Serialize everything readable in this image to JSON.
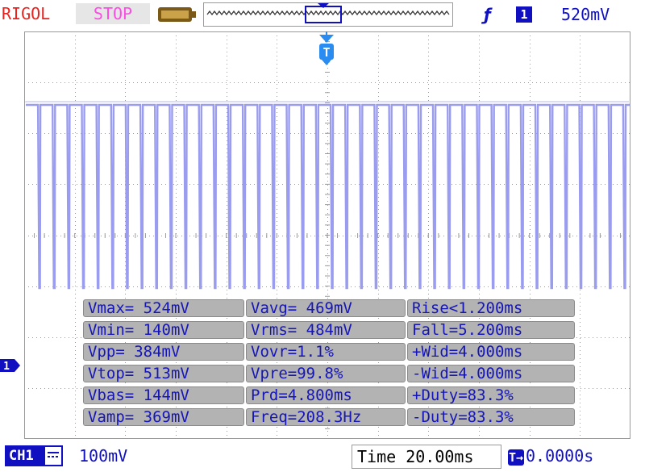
{
  "header": {
    "brand": "RIGOL",
    "run_state": "STOP",
    "trigger": {
      "edge_symbol": "ƒ",
      "source": "1",
      "level": "520mV"
    }
  },
  "trigger_marker_label": "T",
  "channel_marker_label": "1",
  "waveform": {
    "description": "square pulse train, CH1",
    "high_mV": 513,
    "low_mV": 144,
    "pulse_count": 41
  },
  "measurements": {
    "col1": [
      "Vmax= 524mV",
      "Vmin= 140mV",
      "Vpp= 384mV",
      "Vtop= 513mV",
      "Vbas= 144mV",
      "Vamp= 369mV"
    ],
    "col2": [
      "Vavg= 469mV",
      "Vrms= 484mV",
      "Vovr=1.1%",
      "Vpre=99.8%",
      "Prd=4.800ms",
      "Freq=208.3Hz"
    ],
    "col3": [
      "Rise<1.200ms",
      "Fall=5.200ms",
      "+Wid=4.000ms",
      "-Wid=4.000ms",
      "+Duty=83.3%",
      "-Duty=83.3%"
    ]
  },
  "footer": {
    "channel_label": "CH1",
    "channel_scale": "100mV",
    "time_scale": "Time 20.00ms",
    "time_offset_icon": "T→",
    "time_offset": "0.0000s"
  },
  "colors": {
    "trace": "#9a9cf0",
    "grid": "#9a9a9a",
    "measure_text": "#1515b8",
    "accent_blue": "#1010c0",
    "brand_red": "#e8231f",
    "stop_magenta": "#ff4be6"
  }
}
